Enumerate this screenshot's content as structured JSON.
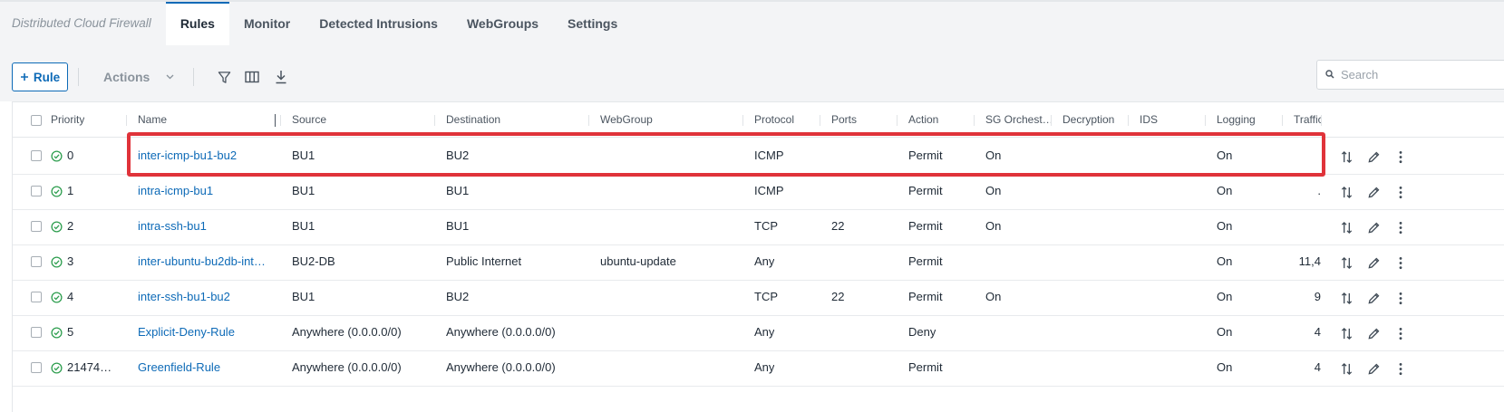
{
  "app": {
    "title": "Distributed Cloud Firewall"
  },
  "tabs": [
    {
      "label": "Rules",
      "active": true
    },
    {
      "label": "Monitor",
      "active": false
    },
    {
      "label": "Detected Intrusions",
      "active": false
    },
    {
      "label": "WebGroups",
      "active": false
    },
    {
      "label": "Settings",
      "active": false
    }
  ],
  "toolbar": {
    "rule_button_label": "Rule",
    "rule_button_icon": "plus-icon",
    "actions_label": "Actions",
    "actions_icon": "chevron-down-icon",
    "icons": [
      "filter-icon",
      "columns-icon",
      "download-icon"
    ],
    "search_placeholder": "Search",
    "search_value": ""
  },
  "table": {
    "columns": {
      "priority": "Priority",
      "name": "Name",
      "source": "Source",
      "destination": "Destination",
      "webgroup": "WebGroup",
      "protocol": "Protocol",
      "ports": "Ports",
      "action": "Action",
      "sg": "SG Orchest…",
      "decryption": "Decryption",
      "ids": "IDS",
      "logging": "Logging",
      "traffic": "Traffic"
    },
    "rows": [
      {
        "priority": "0",
        "name": "inter-icmp-bu1-bu2",
        "source": "BU1",
        "destination": "BU2",
        "webgroup": "",
        "protocol": "ICMP",
        "ports": "",
        "action": "Permit",
        "sg": "On",
        "decryption": "",
        "ids": "",
        "logging": "On",
        "traffic": ""
      },
      {
        "priority": "1",
        "name": "intra-icmp-bu1",
        "source": "BU1",
        "destination": "BU1",
        "webgroup": "",
        "protocol": "ICMP",
        "ports": "",
        "action": "Permit",
        "sg": "On",
        "decryption": "",
        "ids": "",
        "logging": "On",
        "traffic": "."
      },
      {
        "priority": "2",
        "name": "intra-ssh-bu1",
        "source": "BU1",
        "destination": "BU1",
        "webgroup": "",
        "protocol": "TCP",
        "ports": "22",
        "action": "Permit",
        "sg": "On",
        "decryption": "",
        "ids": "",
        "logging": "On",
        "traffic": ""
      },
      {
        "priority": "3",
        "name": "inter-ubuntu-bu2db-int…",
        "source": "BU2-DB",
        "destination": "Public Internet",
        "webgroup": "ubuntu-update",
        "protocol": "Any",
        "ports": "",
        "action": "Permit",
        "sg": "",
        "decryption": "",
        "ids": "",
        "logging": "On",
        "traffic": "11,4"
      },
      {
        "priority": "4",
        "name": "inter-ssh-bu1-bu2",
        "source": "BU1",
        "destination": "BU2",
        "webgroup": "",
        "protocol": "TCP",
        "ports": "22",
        "action": "Permit",
        "sg": "On",
        "decryption": "",
        "ids": "",
        "logging": "On",
        "traffic": "9"
      },
      {
        "priority": "5",
        "name": "Explicit-Deny-Rule",
        "source": "Anywhere (0.0.0.0/0)",
        "destination": "Anywhere (0.0.0.0/0)",
        "webgroup": "",
        "protocol": "Any",
        "ports": "",
        "action": "Deny",
        "sg": "",
        "decryption": "",
        "ids": "",
        "logging": "On",
        "traffic": "4"
      },
      {
        "priority": "21474…",
        "name": "Greenfield-Rule",
        "source": "Anywhere (0.0.0.0/0)",
        "destination": "Anywhere (0.0.0.0/0)",
        "webgroup": "",
        "protocol": "Any",
        "ports": "",
        "action": "Permit",
        "sg": "",
        "decryption": "",
        "ids": "",
        "logging": "On",
        "traffic": "4"
      }
    ],
    "row_icons": [
      "status-enabled-icon",
      "reorder-icon",
      "edit-pencil-icon",
      "more-vertical-icon"
    ]
  },
  "colors": {
    "accent": "#0d6ab7",
    "status_ok": "#2e9e4f",
    "highlight": "#e0333a"
  }
}
